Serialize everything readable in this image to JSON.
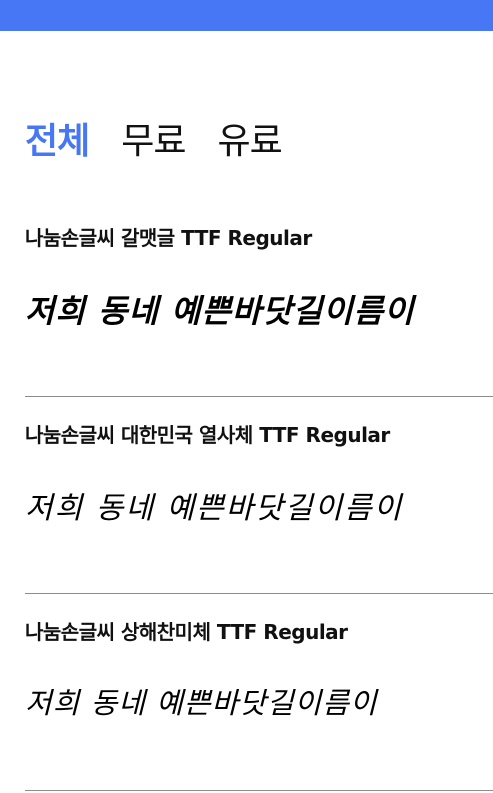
{
  "header": {
    "accent_color": "#4777f5"
  },
  "tabs": [
    {
      "label": "전체",
      "active": true
    },
    {
      "label": "무료",
      "active": false
    },
    {
      "label": "유료",
      "active": false
    }
  ],
  "fonts": [
    {
      "name": "나눔손글씨 갈맷글 TTF Regular",
      "sample": "저희 동네 예쁜바닷길이름이"
    },
    {
      "name": "나눔손글씨 대한민국 열사체 TTF Regular",
      "sample": "저희 동네 예쁜바닷길이름이"
    },
    {
      "name": "나눔손글씨 상해찬미체 TTF Regular",
      "sample": "저희 동네 예쁜바닷길이름이"
    }
  ]
}
